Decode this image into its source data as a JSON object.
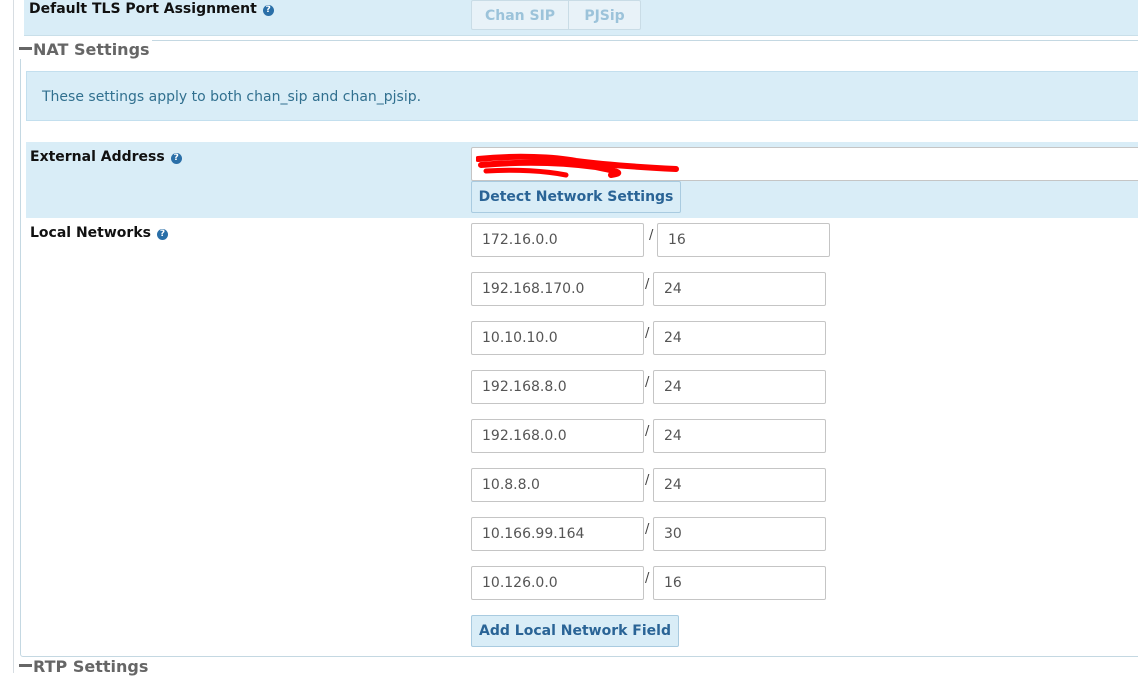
{
  "tls": {
    "label": "Default TLS Port Assignment",
    "options": [
      "Chan SIP",
      "PJSip"
    ]
  },
  "nat": {
    "title": "NAT Settings",
    "info": "These settings apply to both chan_sip and chan_pjsip.",
    "external_address": {
      "label": "External Address",
      "value": "",
      "detect_button": "Detect Network Settings"
    },
    "local_networks": {
      "label": "Local Networks",
      "rows": [
        {
          "ip": "172.16.0.0",
          "mask": "16"
        },
        {
          "ip": "192.168.170.0",
          "mask": "24"
        },
        {
          "ip": "10.10.10.0",
          "mask": "24"
        },
        {
          "ip": "192.168.8.0",
          "mask": "24"
        },
        {
          "ip": "192.168.0.0",
          "mask": "24"
        },
        {
          "ip": "10.8.8.0",
          "mask": "24"
        },
        {
          "ip": "10.166.99.164",
          "mask": "30"
        },
        {
          "ip": "10.126.0.0",
          "mask": "16"
        }
      ],
      "slash": "/",
      "add_button": "Add Local Network Field"
    }
  },
  "rtp": {
    "title": "RTP Settings"
  },
  "icons": {
    "help": "question-circle-icon",
    "collapse": "minus-icon"
  },
  "colors": {
    "panel": "#d9edf7",
    "accent": "#2a6496",
    "info_text": "#31708f"
  }
}
